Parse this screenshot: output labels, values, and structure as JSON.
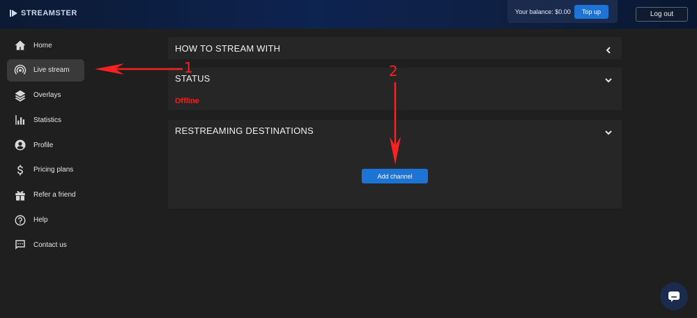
{
  "header": {
    "logo_text": "STREAMSTER",
    "balance_text": "Your balance: $0.00",
    "topup_label": "Top up",
    "logout_label": "Log out"
  },
  "sidebar": {
    "items": [
      {
        "label": "Home",
        "icon": "home-icon"
      },
      {
        "label": "Live stream",
        "icon": "broadcast-icon",
        "active": true
      },
      {
        "label": "Overlays",
        "icon": "layers-icon"
      },
      {
        "label": "Statistics",
        "icon": "bar-chart-icon"
      },
      {
        "label": "Profile",
        "icon": "user-icon"
      },
      {
        "label": "Pricing plans",
        "icon": "dollar-icon"
      },
      {
        "label": "Refer a friend",
        "icon": "gift-icon"
      },
      {
        "label": "Help",
        "icon": "help-icon"
      },
      {
        "label": "Contact us",
        "icon": "chat-icon"
      }
    ]
  },
  "main": {
    "how_to_title": "HOW TO STREAM WITH",
    "status_title": "STATUS",
    "status_value": "Offline",
    "restream_title": "RESTREAMING DESTINATIONS",
    "add_channel_label": "Add channel"
  },
  "annotations": {
    "label_1": "1",
    "label_2": "2"
  },
  "colors": {
    "accent": "#1e74d6",
    "status_offline": "#ff1a1a",
    "annotation": "#ff2020",
    "background": "#1f1f1f",
    "panel": "#262626"
  }
}
